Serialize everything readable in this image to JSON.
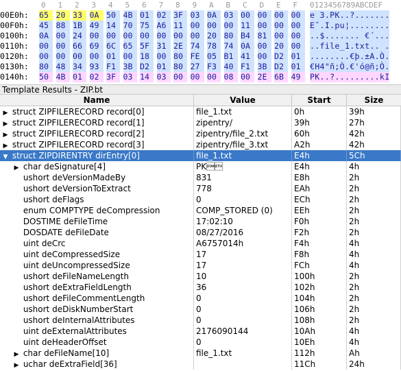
{
  "hex_view": {
    "column_digits": [
      "0",
      "1",
      "2",
      "3",
      "4",
      "5",
      "6",
      "7",
      "8",
      "9",
      "A",
      "B",
      "C",
      "D",
      "E",
      "F"
    ],
    "ascii_header": "0123456789ABCDEF",
    "rows": [
      {
        "addr": "00E0h:",
        "bytes": [
          "65",
          "20",
          "33",
          "0A",
          "50",
          "4B",
          "01",
          "02",
          "3F",
          "03",
          "0A",
          "03",
          "00",
          "00",
          "00",
          "00"
        ],
        "ascii": "e 3.PK..?.......",
        "yellow": 4
      },
      {
        "addr": "00F0h:",
        "bytes": [
          "45",
          "88",
          "1B",
          "49",
          "14",
          "70",
          "75",
          "A6",
          "11",
          "00",
          "00",
          "00",
          "11",
          "00",
          "00",
          "00"
        ],
        "ascii": "Eˆ.I.pu¦........"
      },
      {
        "addr": "0100h:",
        "bytes": [
          "0A",
          "00",
          "24",
          "00",
          "00",
          "00",
          "00",
          "00",
          "00",
          "00",
          "20",
          "80",
          "B4",
          "81",
          "00",
          "00"
        ],
        "ascii": "..$....... €´..."
      },
      {
        "addr": "0110h:",
        "bytes": [
          "00",
          "00",
          "66",
          "69",
          "6C",
          "65",
          "5F",
          "31",
          "2E",
          "74",
          "78",
          "74",
          "0A",
          "00",
          "20",
          "00"
        ],
        "ascii": "..file_1.txt.. ."
      },
      {
        "addr": "0120h:",
        "bytes": [
          "00",
          "00",
          "00",
          "00",
          "01",
          "00",
          "18",
          "00",
          "80",
          "FE",
          "05",
          "B1",
          "41",
          "00",
          "D2",
          "01"
        ],
        "ascii": "........€þ.±A.Ò."
      },
      {
        "addr": "0130h:",
        "bytes": [
          "80",
          "48",
          "34",
          "93",
          "F1",
          "3B",
          "D2",
          "01",
          "80",
          "27",
          "F3",
          "40",
          "F1",
          "3B",
          "D2",
          "01"
        ],
        "ascii": "€H4\"ñ;Ò.€'ó@ñ;Ò."
      },
      {
        "addr": "0140h:",
        "bytes": [
          "50",
          "4B",
          "01",
          "02",
          "3F",
          "03",
          "14",
          "03",
          "00",
          "00",
          "00",
          "08",
          "00",
          "2E",
          "6B",
          "49"
        ],
        "ascii": "PK..?.........kI"
      }
    ]
  },
  "template_title": "Template Results - ZIP.bt",
  "columns": {
    "name": "Name",
    "value": "Value",
    "start": "Start",
    "size": "Size"
  },
  "rows": [
    {
      "indent": 0,
      "arrow": "right",
      "name": "struct ZIPFILERECORD record[0]",
      "value": "file_1.txt",
      "start": "0h",
      "size": "39h"
    },
    {
      "indent": 0,
      "arrow": "right",
      "name": "struct ZIPFILERECORD record[1]",
      "value": "zipentry/",
      "start": "39h",
      "size": "27h"
    },
    {
      "indent": 0,
      "arrow": "right",
      "name": "struct ZIPFILERECORD record[2]",
      "value": "zipentry/file_2.txt",
      "start": "60h",
      "size": "42h"
    },
    {
      "indent": 0,
      "arrow": "right",
      "name": "struct ZIPFILERECORD record[3]",
      "value": "zipentry/file_3.txt",
      "start": "A2h",
      "size": "42h"
    },
    {
      "indent": 0,
      "arrow": "down",
      "name": "struct ZIPDIRENTRY dirEntry[0]",
      "value": "file_1.txt",
      "start": "E4h",
      "size": "5Ch",
      "selected": true
    },
    {
      "indent": 1,
      "arrow": "right",
      "name": "char deSignature[4]",
      "value": "PK\u0001\u0002",
      "start": "E4h",
      "size": "4h"
    },
    {
      "indent": 1,
      "arrow": "",
      "name": "ushort deVersionMadeBy",
      "value": "831",
      "start": "E8h",
      "size": "2h"
    },
    {
      "indent": 1,
      "arrow": "",
      "name": "ushort deVersionToExtract",
      "value": "778",
      "start": "EAh",
      "size": "2h"
    },
    {
      "indent": 1,
      "arrow": "",
      "name": "ushort deFlags",
      "value": "0",
      "start": "ECh",
      "size": "2h"
    },
    {
      "indent": 1,
      "arrow": "",
      "name": "enum COMPTYPE deCompression",
      "value": "COMP_STORED (0)",
      "start": "EEh",
      "size": "2h"
    },
    {
      "indent": 1,
      "arrow": "",
      "name": "DOSTIME deFileTime",
      "value": "17:02:10",
      "start": "F0h",
      "size": "2h"
    },
    {
      "indent": 1,
      "arrow": "",
      "name": "DOSDATE deFileDate",
      "value": "08/27/2016",
      "start": "F2h",
      "size": "2h"
    },
    {
      "indent": 1,
      "arrow": "",
      "name": "uint deCrc",
      "value": "A6757014h",
      "start": "F4h",
      "size": "4h"
    },
    {
      "indent": 1,
      "arrow": "",
      "name": "uint deCompressedSize",
      "value": "17",
      "start": "F8h",
      "size": "4h"
    },
    {
      "indent": 1,
      "arrow": "",
      "name": "uint deUncompressedSize",
      "value": "17",
      "start": "FCh",
      "size": "4h"
    },
    {
      "indent": 1,
      "arrow": "",
      "name": "ushort deFileNameLength",
      "value": "10",
      "start": "100h",
      "size": "2h"
    },
    {
      "indent": 1,
      "arrow": "",
      "name": "ushort deExtraFieldLength",
      "value": "36",
      "start": "102h",
      "size": "2h"
    },
    {
      "indent": 1,
      "arrow": "",
      "name": "ushort deFileCommentLength",
      "value": "0",
      "start": "104h",
      "size": "2h"
    },
    {
      "indent": 1,
      "arrow": "",
      "name": "ushort deDiskNumberStart",
      "value": "0",
      "start": "106h",
      "size": "2h"
    },
    {
      "indent": 1,
      "arrow": "",
      "name": "ushort deInternalAttributes",
      "value": "0",
      "start": "108h",
      "size": "2h"
    },
    {
      "indent": 1,
      "arrow": "",
      "name": "uint deExternalAttributes",
      "value": "2176090144",
      "start": "10Ah",
      "size": "4h"
    },
    {
      "indent": 1,
      "arrow": "",
      "name": "uint deHeaderOffset",
      "value": "0",
      "start": "10Eh",
      "size": "4h"
    },
    {
      "indent": 1,
      "arrow": "right",
      "name": "char deFileName[10]",
      "value": "file_1.txt",
      "start": "112h",
      "size": "Ah"
    },
    {
      "indent": 1,
      "arrow": "right",
      "name": "uchar deExtraField[36]",
      "value": "",
      "start": "11Ch",
      "size": "24h"
    }
  ],
  "colors": {
    "selection": "#3a78c8",
    "hex_highlight": "#ffff66",
    "ascii_highlight": "#cfe3ff"
  }
}
